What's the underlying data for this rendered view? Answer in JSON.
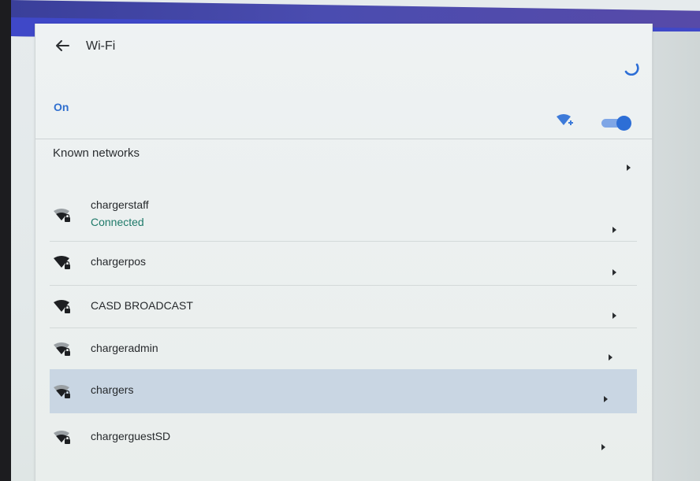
{
  "header": {
    "title": "Wi-Fi"
  },
  "wifi": {
    "state_label": "On",
    "enabled": true
  },
  "known_networks": {
    "label": "Known networks"
  },
  "networks": [
    {
      "name": "chargerstaff",
      "status": "Connected",
      "signal": "medium"
    },
    {
      "name": "chargerpos",
      "status": "",
      "signal": "full"
    },
    {
      "name": "CASD BROADCAST",
      "status": "",
      "signal": "full"
    },
    {
      "name": "chargeradmin",
      "status": "",
      "signal": "medium"
    },
    {
      "name": "chargers",
      "status": "",
      "signal": "medium",
      "selected": true
    },
    {
      "name": "chargerguestSD",
      "status": "",
      "signal": "medium"
    }
  ],
  "colors": {
    "accent": "#2f6fcf",
    "connected": "#1f7a6a",
    "selected_row": "#c9d6e3",
    "top_bar": "#3f48c8"
  },
  "icons": {
    "back": "arrow-left-icon",
    "spinner": "loading-spinner-icon",
    "add_network": "wifi-add-icon",
    "network": "wifi-lock-icon",
    "chevron": "chevron-right-icon"
  }
}
